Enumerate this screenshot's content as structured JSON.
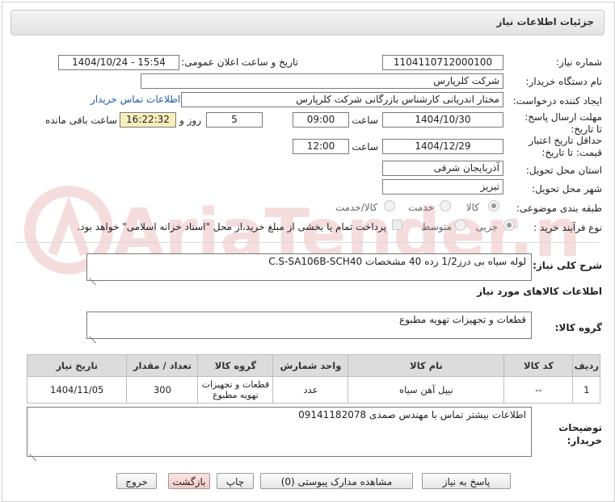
{
  "header": {
    "title": "جزئیات اطلاعات نیاز"
  },
  "fields": {
    "need_number_label": "شماره نیاز:",
    "need_number": "1104110712000100",
    "announce_label": "تاریخ و ساعت اعلان عمومی:",
    "announce_value": "1404/10/24 - 15:54",
    "buyer_org_label": "نام دستگاه خریدار:",
    "buyer_org": "شرکت کلرپارس",
    "creator_label": "ایجاد کننده درخواست:",
    "creator": "مختار اندریانی کارشناس بازرگانی شرکت کلرپارس",
    "contact_link": "اطلاعات تماس خریدار",
    "deadline_label": "مهلت ارسال پاسخ: تا تاریخ:",
    "deadline_date": "1404/10/30",
    "time_label": "ساعت",
    "deadline_time": "09:00",
    "days_value": "5",
    "days_label": "روز و",
    "remaining_time": "16:22:32",
    "remaining_label": "ساعت باقی مانده",
    "validity_label": "حداقل تاریخ اعتبار قیمت: تا تاریخ:",
    "validity_date": "1404/12/29",
    "validity_time": "12:00",
    "province_label": "استان محل تحویل:",
    "province": "آذربایجان شرقی",
    "city_label": "شهر محل تحویل:",
    "city": "تبریز",
    "category_label": "طبقه بندی موضوعی:",
    "category_options": [
      "کالا",
      "خدمت",
      "کالا/خدمت"
    ],
    "process_label": "نوع فرآیند خرید :",
    "process_options": [
      "جزیی",
      "متوسط"
    ],
    "treasury_note": "پرداخت تمام یا بخشی از مبلغ خرید،از محل \"اسناد خزانه اسلامی\" خواهد بود."
  },
  "description": {
    "label": "شرح کلی نیاز:",
    "text": "لوله سیاه بی درز1/2 رده 40 مشخصات C.S-SA106B-SCH40"
  },
  "goods_section": {
    "title": "اطلاعات کالاهای مورد نیاز"
  },
  "goods_group": {
    "label": "گروه کالا:",
    "value": "قطعات و تجهیزات تهویه مطبوع"
  },
  "table": {
    "headers": [
      "ردیف",
      "کد کالا",
      "نام کالا",
      "واحد شمارش",
      "گروه کالا",
      "تعداد / مقدار",
      "تاریخ نیاز"
    ],
    "rows": [
      [
        "1",
        "--",
        "نیپل آهن سیاه",
        "عدد",
        "قطعات و تجهیزات تهویه مطبوع",
        "300",
        "1404/11/05"
      ]
    ]
  },
  "buyer_notes": {
    "label": "توضیحات خریدار:",
    "text": "اطلاعات بیشتر تماس با مهندس صمدی 09141182078"
  },
  "buttons": {
    "reply": "پاسخ به نیاز",
    "attachments": "مشاهده مدارک پیوستی (0)",
    "print": "چاپ",
    "back": "بازگشت",
    "exit": "خروج"
  },
  "watermark": {
    "text": "AriaTender.net"
  },
  "colors": {
    "link": "#1f57b5",
    "highlight": "#f6efbd",
    "pink_button": "#f2c9c9",
    "header_bg": "#e2e2e2"
  }
}
